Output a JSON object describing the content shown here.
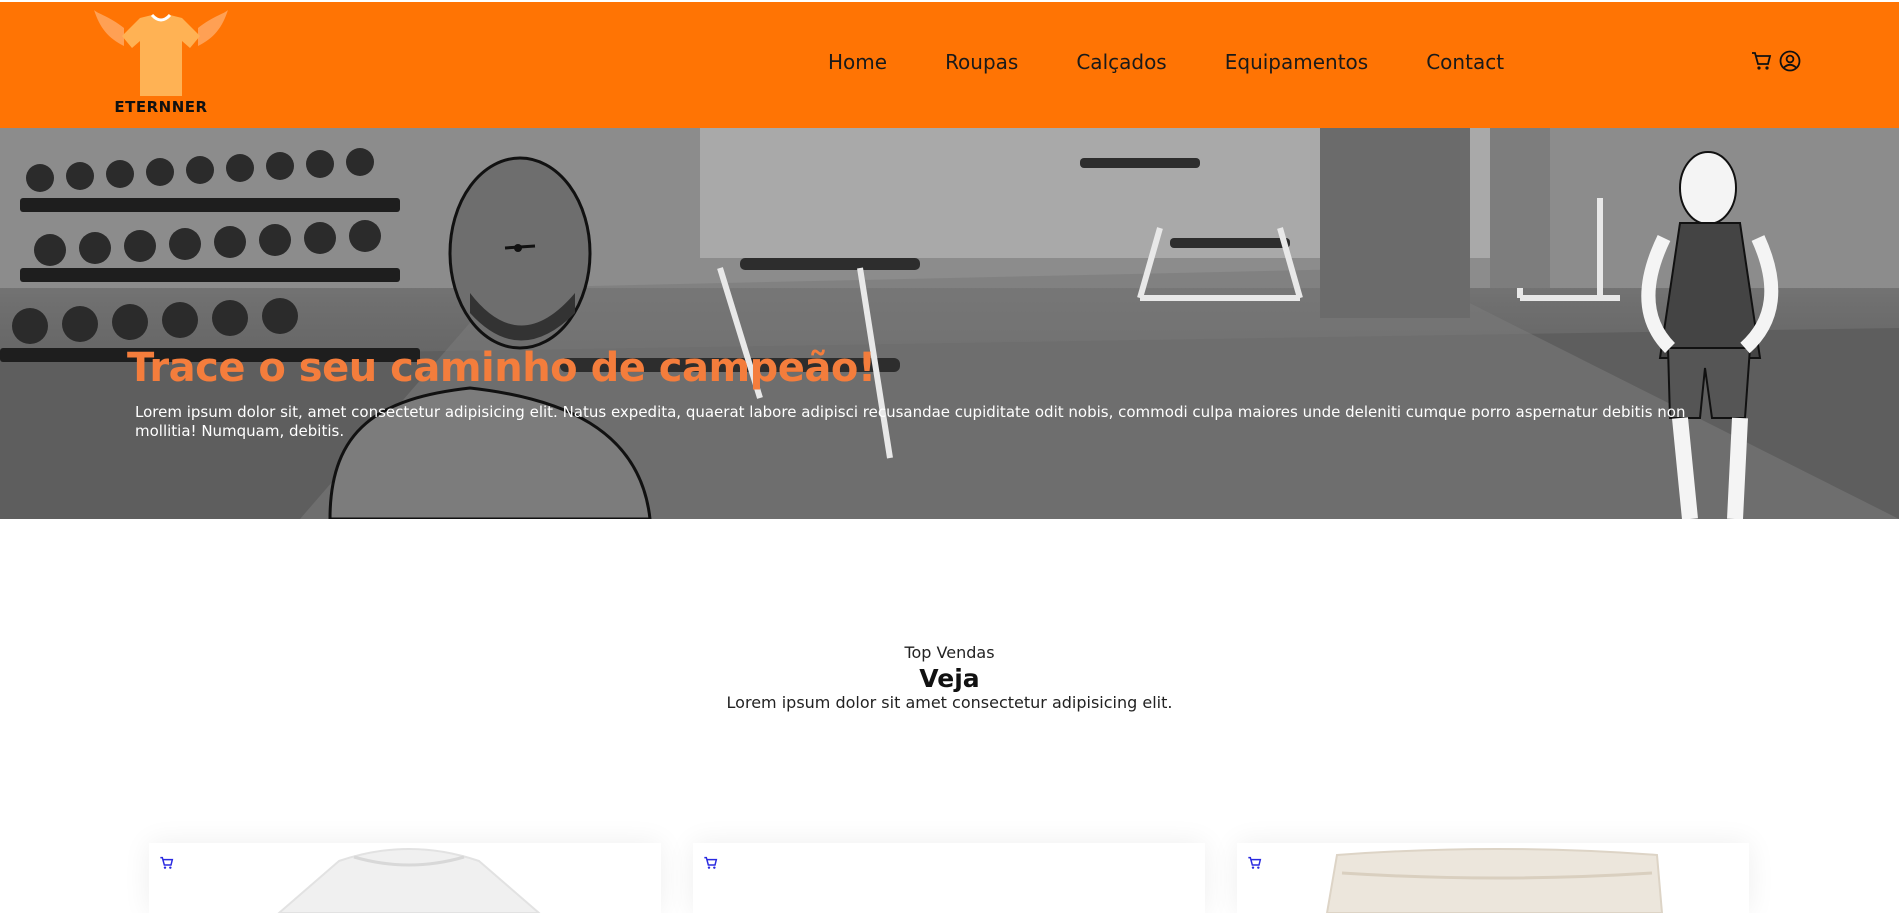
{
  "brand": {
    "name": "ETERNNER",
    "accent": "#ff7404",
    "title_color": "#f47d3c"
  },
  "nav": {
    "items": [
      {
        "label": "Home"
      },
      {
        "label": "Roupas"
      },
      {
        "label": "Calçados"
      },
      {
        "label": "Equipamentos"
      },
      {
        "label": "Contact"
      }
    ]
  },
  "header_icons": [
    "cart-icon",
    "user-icon"
  ],
  "hero": {
    "title": "Trace o seu caminho de campeão!",
    "text": "Lorem ipsum dolor sit, amet consectetur adipisicing elit. Natus expedita, quaerat labore adipisci recusandae cupiditate odit nobis, commodi culpa maiores unde deleniti cumque porro aspernatur debitis non mollitia! Numquam, debitis."
  },
  "section": {
    "kicker": "Top Vendas",
    "title": "Veja",
    "description": "Lorem ipsum dolor sit amet consectetur adipisicing elit."
  },
  "products": [
    {
      "icon": "cart-icon",
      "image": "white-tshirt"
    },
    {
      "icon": "cart-icon",
      "image": "blank"
    },
    {
      "icon": "cart-icon",
      "image": "beige-shorts"
    }
  ]
}
